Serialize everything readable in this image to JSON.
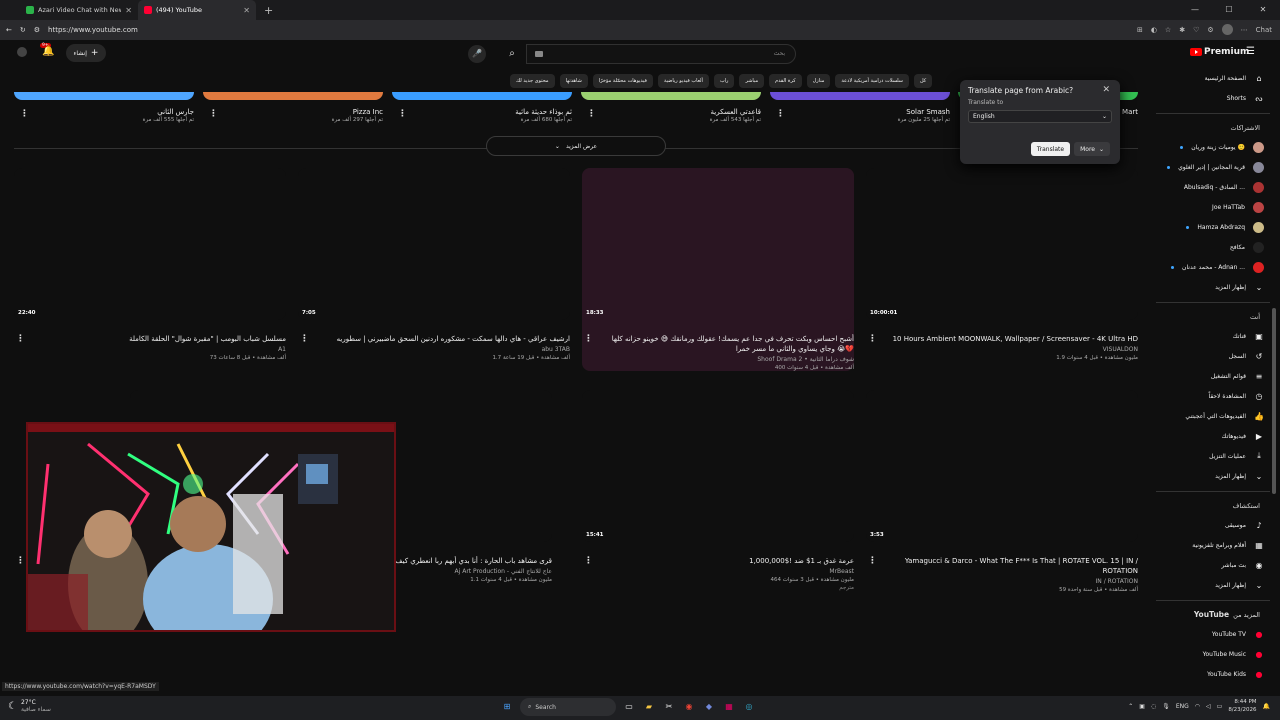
{
  "browser": {
    "tabs": [
      {
        "title": "Azari Video Chat with New Fr...",
        "fav": "#2bb34a"
      },
      {
        "title": "(494) YouTube",
        "fav": "#ff0033",
        "active": true
      }
    ],
    "new_tab": "+",
    "url": "https://www.youtube.com",
    "chat_label": "Chat"
  },
  "header": {
    "create_label": "إنشاء",
    "notif_count": "9+",
    "search_placeholder": "بحث",
    "premium_label": "Premium"
  },
  "chips": [
    "كل",
    "سلسلات درامية أمريكية لاذعة",
    "منازل",
    "كرة القدم",
    "مباشر",
    "راب",
    "ألعاب فيديو رياضية",
    "فيديوهات محمّلة مؤخرًا",
    "شاهدتها",
    "محتوى جديد لك"
  ],
  "shorts": [
    {
      "title": "جارس الثاني",
      "views": "تم أجلها 555 ألف مرة",
      "color": "#4fa6ff"
    },
    {
      "title": "Pizza Inc",
      "views": "تم أجلها 297 ألف مرة",
      "color": "#e07a3f"
    },
    {
      "title": "ثم بوذاء حديثة ماثية",
      "views": "تم أجلها 680 ألف مرة",
      "color": "#3a9dff"
    },
    {
      "title": "قاعدتي العسكرية",
      "views": "تم أجلها 543 ألف مرة",
      "color": "#9bd070"
    },
    {
      "title": "Solar Smash",
      "views": "تم أجلها 25 مليون مرة",
      "color": "#6b4fd6"
    },
    {
      "title": "Mart",
      "views": "",
      "color": "#33c152"
    }
  ],
  "show_more_label": "عرض المزيد",
  "videos_row1": [
    {
      "duration": "22:40",
      "title": "مسلسل شباب البومب | \"مقبرة شوال\" الحلقة الكاملة",
      "channel": "A1",
      "meta": "73 ألف مشاهدة • قبل 8 ساعات"
    },
    {
      "duration": "7:05",
      "title": "ارشيف عراقي - هاي دالها سمكت - مشكوره اردنين السحق ماضبيرني | سطوريه",
      "channel": "abu 3TAB",
      "meta": "1.7 ألف مشاهدة • قبل 19 ساعة"
    },
    {
      "duration": "18:33",
      "title": "أشبح احساس وبكت تحرف في جدا عم يسمك! عقولك ورمانقك 😅 خوينو حزانه كلها وجاي يساوي والثاني ما مسر خمرا 😭💔",
      "channel": "Shoof Drama 2 • شوف دراما الثانية",
      "meta": "400 ألف مشاهدة • قبل 4 سنوات"
    },
    {
      "duration": "10:00:01",
      "title": "10 Hours Ambient MOONWALK, Wallpaper / Screensaver - 4K Ultra HD",
      "channel": "VISUALDON",
      "meta": "1.9 مليون مشاهدة • قبل 4 سنوات"
    }
  ],
  "videos_row2": [
    {
      "duration": "1",
      "title": "قرى مشاهد باب الحارة : أنا بدي أبهم ربا انعطري كيف الف خ",
      "channel": "Aj Art Production - عاج للانتاج الفني",
      "meta": "1.1 مليون مشاهدة • قبل 4 سنوات"
    },
    {
      "duration": "15:41",
      "title": "عرمة غدق بـ 1$ ضد !$1,000,000",
      "channel": "MrBeast",
      "meta": "464 مليون مشاهدة • قبل 3 سنوات",
      "badge": "مترجم"
    },
    {
      "duration": "3:53",
      "title": "Yamagucci & Darco - What The F*** Is That | ROTATE VOL. 15 | IN / ROTATION",
      "channel": "IN / ROTATION",
      "meta": "59 ألف مشاهدة • قبل سنة واحدة"
    }
  ],
  "translate": {
    "title": "Translate page from Arabic?",
    "sub": "Translate to",
    "language": "English",
    "translate_btn": "Translate",
    "more_btn": "More"
  },
  "sidebar": {
    "main": [
      {
        "label": "الصفحة الرئيسية",
        "icon": "⌂"
      },
      {
        "label": "Shorts",
        "icon": "ᔓ"
      }
    ],
    "subs_header": "الاشتراكات",
    "subs": [
      {
        "label": "يوميات زينة وريان 🙂",
        "color": "#c98"
      },
      {
        "label": "قرية المجانين | إدير الغلوي",
        "color": "#889"
      },
      {
        "label": "Abulsadiq - السادق ...",
        "color": "#a33"
      },
      {
        "label": "Joe HaTTab",
        "color": "#b44"
      },
      {
        "label": "Hamza Abdrazq",
        "color": "#cb8"
      },
      {
        "label": "مكافح",
        "color": "#222"
      },
      {
        "label": "محمد عدنان - Adnan ...",
        "color": "#d22"
      }
    ],
    "subs_more": "إظهار المزيد",
    "you_header": "أنت",
    "you": [
      {
        "label": "قناتك",
        "icon": "▣"
      },
      {
        "label": "السجل",
        "icon": "↺"
      },
      {
        "label": "قوائم التشغيل",
        "icon": "≡"
      },
      {
        "label": "المشاهدة لاحقاً",
        "icon": "◷"
      },
      {
        "label": "الفيديوهات التي أعجبتني",
        "icon": "👍"
      },
      {
        "label": "فيديوهاتك",
        "icon": "▶"
      },
      {
        "label": "عمليات التنزيل",
        "icon": "⤓"
      }
    ],
    "you_more": "إظهار المزيد",
    "explore_header": "استكشاف",
    "explore": [
      {
        "label": "موسيقى",
        "icon": "♪"
      },
      {
        "label": "أفلام وبرامج تلفزيونية",
        "icon": "▦"
      },
      {
        "label": "بث مباشر",
        "icon": "◉"
      }
    ],
    "explore_more": "إظهار المزيد",
    "more_header_yt": "YouTube",
    "more_header_from": "المزيد من",
    "more": [
      {
        "label": "YouTube TV"
      },
      {
        "label": "YouTube Music"
      },
      {
        "label": "YouTube Kids"
      }
    ]
  },
  "status_url": "https://www.youtube.com/watch?v=yqE-R7aMSDY",
  "taskbar": {
    "temp": "27°C",
    "weather": "سماء صافية",
    "search": "Search",
    "lang": "ENG",
    "time": "8:44 PM",
    "date": "8/23/2026"
  }
}
